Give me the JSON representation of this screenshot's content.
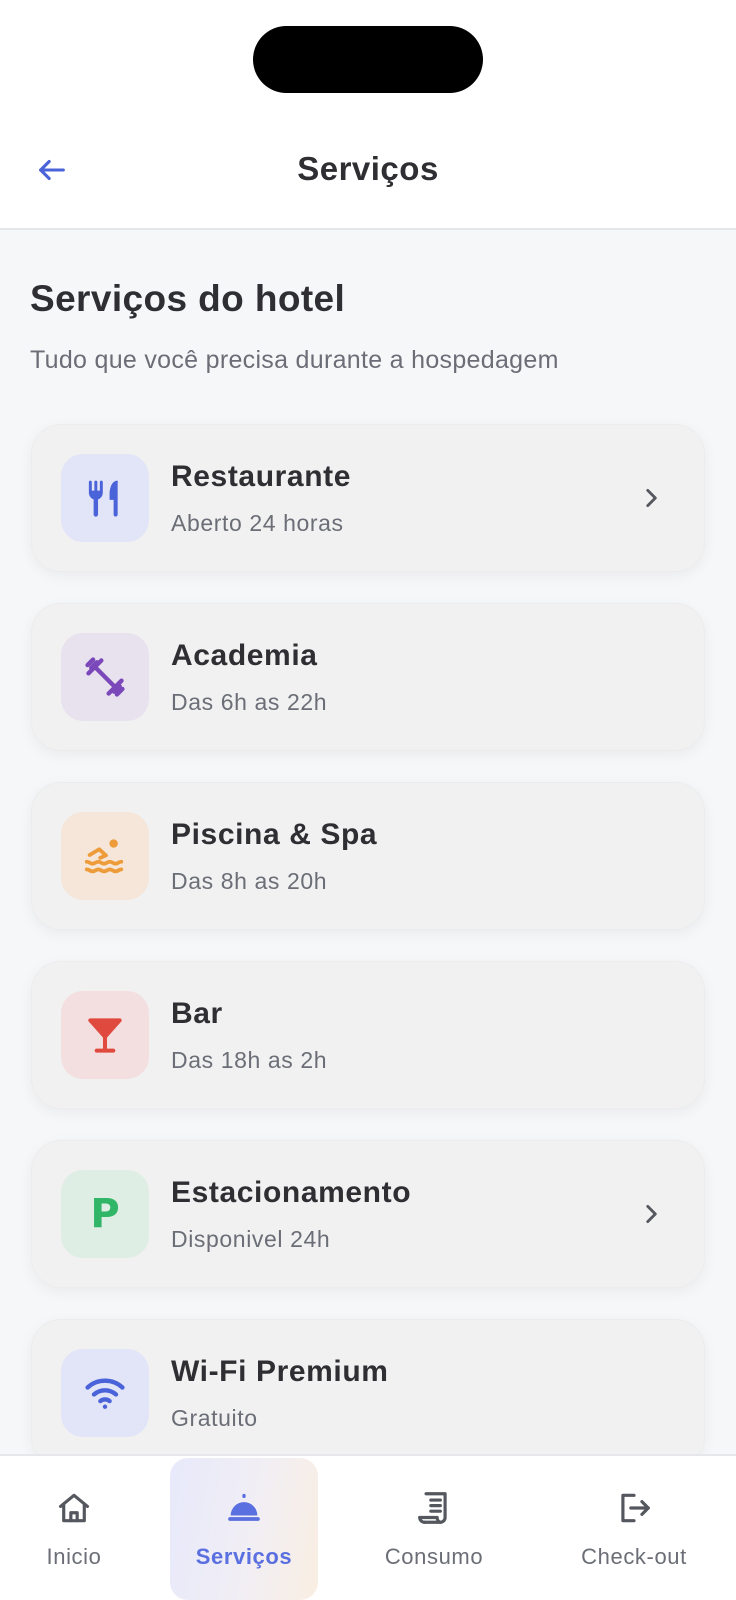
{
  "header": {
    "title": "Serviços",
    "back_icon": "arrow-left-icon"
  },
  "section": {
    "title": "Serviços do hotel",
    "subtitle": "Tudo que você precisa durante a hospedagem"
  },
  "services": [
    {
      "name": "Restaurante",
      "detail": "Aberto 24 horas",
      "icon": "utensils-icon",
      "icon_color": "#4a63d9",
      "bg": "#e2e4f7",
      "has_chevron": true
    },
    {
      "name": "Academia",
      "detail": "Das 6h as 22h",
      "icon": "dumbbell-icon",
      "icon_color": "#7a48b8",
      "bg": "#e8e1ee",
      "has_chevron": false
    },
    {
      "name": "Piscina & Spa",
      "detail": "Das 8h as 20h",
      "icon": "swimmer-icon",
      "icon_color": "#ee9b3a",
      "bg": "#f5e6d9",
      "has_chevron": false
    },
    {
      "name": "Bar",
      "detail": "Das 18h as 2h",
      "icon": "cocktail-icon",
      "icon_color": "#e0493e",
      "bg": "#f3dfdf",
      "has_chevron": false
    },
    {
      "name": "Estacionamento",
      "detail": "Disponivel 24h",
      "icon": "parking-icon",
      "icon_color": "#31b566",
      "icon_text": "P",
      "bg": "#dfeee4",
      "has_chevron": true
    },
    {
      "name": "Wi-Fi Premium",
      "detail": "Gratuito",
      "icon": "wifi-icon",
      "icon_color": "#4a63d9",
      "bg": "#e2e4f7",
      "has_chevron": false
    }
  ],
  "nav": {
    "active": "Serviços",
    "items": [
      {
        "label": "Inicio",
        "icon": "home-icon"
      },
      {
        "label": "Serviços",
        "icon": "service-bell-icon"
      },
      {
        "label": "Consumo",
        "icon": "receipt-icon"
      },
      {
        "label": "Check-out",
        "icon": "logout-icon"
      }
    ]
  },
  "colors": {
    "accent": "#5a6fe0",
    "text": "#2f2f33",
    "muted": "#6b6e76"
  }
}
